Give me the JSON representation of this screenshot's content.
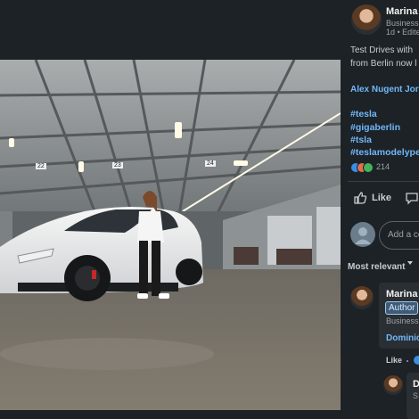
{
  "post": {
    "author": "Marina",
    "author_meta": "Business",
    "time": "1d • Edite",
    "text_line1": "Test Drives with",
    "text_line2": "from Berlin now l",
    "mention": "Alex Nugent Jor",
    "hashtags": [
      "#tesla",
      "#gigaberlin",
      "#tsla",
      "#teslamodelype"
    ],
    "reaction_count": "214"
  },
  "photo": {
    "pillar_labels": [
      "22",
      "23",
      "24"
    ]
  },
  "actions": {
    "like_label": "Like"
  },
  "comment_box": {
    "placeholder": "Add a co"
  },
  "sort": {
    "label": "Most relevant"
  },
  "comments": [
    {
      "author": "Marina",
      "badge": "Author",
      "meta": "Business",
      "mention": "Dominic",
      "like_label": "Like"
    },
    {
      "author": "D",
      "meta": "S"
    }
  ],
  "colors": {
    "link": "#71b7fb",
    "panel_bg": "#1d2226",
    "author_badge": "#a8c8e8"
  }
}
